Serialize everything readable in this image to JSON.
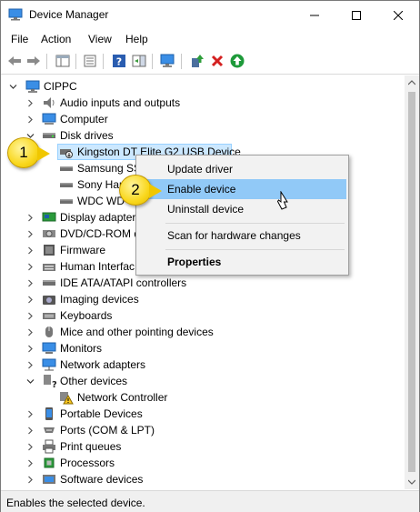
{
  "window": {
    "title": "Device Manager",
    "icon": "device-manager-icon",
    "buttons": [
      "minimize-icon",
      "maximize-icon",
      "close-icon"
    ]
  },
  "menu": {
    "file": "File",
    "action": "Action",
    "view": "View",
    "help": "Help"
  },
  "toolbar": {
    "icons": [
      "back-arrow-icon",
      "forward-arrow-icon",
      "properties-grid-icon",
      "device-list-icon",
      "help-icon",
      "action-pane-icon",
      "monitor-scan-icon",
      "update-driver-icon",
      "uninstall-x-icon",
      "enable-device-icon"
    ]
  },
  "tree": {
    "root": "CIPPC",
    "items": [
      {
        "label": "Audio inputs and outputs",
        "icon": "speaker-icon"
      },
      {
        "label": "Computer",
        "icon": "computer-icon"
      },
      {
        "label": "Disk drives",
        "icon": "disk-drive-icon",
        "expanded": true
      },
      {
        "label": "Kingston DT Elite G2 USB Device",
        "icon": "disabled-drive-icon",
        "selected": true,
        "child": true
      },
      {
        "label": "Samsung SS",
        "icon": "disk-drive-icon",
        "child": true
      },
      {
        "label": "Sony Har",
        "icon": "disk-drive-icon",
        "child": true
      },
      {
        "label": "WDC WD",
        "icon": "disk-drive-icon",
        "child": true
      },
      {
        "label": "Display adapters",
        "icon": "display-adapter-icon"
      },
      {
        "label": "DVD/CD-ROM d",
        "icon": "dvd-icon"
      },
      {
        "label": "Firmware",
        "icon": "firmware-icon"
      },
      {
        "label": "Human Interfac",
        "icon": "hid-icon"
      },
      {
        "label": "IDE ATA/ATAPI controllers",
        "icon": "ide-controller-icon"
      },
      {
        "label": "Imaging devices",
        "icon": "camera-icon"
      },
      {
        "label": "Keyboards",
        "icon": "keyboard-icon"
      },
      {
        "label": "Mice and other pointing devices",
        "icon": "mouse-icon"
      },
      {
        "label": "Monitors",
        "icon": "monitor-icon"
      },
      {
        "label": "Network adapters",
        "icon": "network-adapter-icon"
      },
      {
        "label": "Other devices",
        "icon": "other-devices-icon",
        "expanded": true
      },
      {
        "label": "Network Controller",
        "icon": "warning-device-icon",
        "child": true
      },
      {
        "label": "Portable Devices",
        "icon": "portable-device-icon"
      },
      {
        "label": "Ports (COM & LPT)",
        "icon": "port-icon"
      },
      {
        "label": "Print queues",
        "icon": "printer-icon"
      },
      {
        "label": "Processors",
        "icon": "processor-icon"
      },
      {
        "label": "Software devices",
        "icon": "software-device-icon"
      }
    ]
  },
  "context_menu": {
    "update_driver": "Update driver",
    "enable_device": "Enable device",
    "uninstall_device": "Uninstall device",
    "scan_hardware": "Scan for hardware changes",
    "properties": "Properties"
  },
  "callouts": {
    "step1": "1",
    "step2": "2"
  },
  "status": {
    "text": "Enables the selected device."
  },
  "colors": {
    "selection_bg": "#cce8ff",
    "menu_hover": "#91c9f7",
    "callout_yellow": "#f9d71c"
  }
}
